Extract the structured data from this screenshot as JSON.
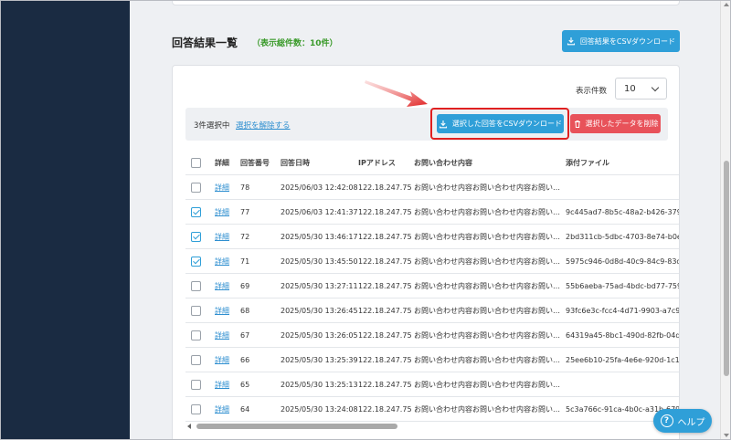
{
  "page": {
    "title": "回答結果一覧",
    "total_count": "（表示総件数：10件）",
    "download_all_label": "回答結果をCSVダウンロード"
  },
  "pagination": {
    "per_page_label": "表示件数",
    "per_page_value": "10"
  },
  "selection": {
    "count_label": "3件選択中",
    "clear_label": "選択を解除する",
    "download_selected_label": "選択した回答をCSVダウンロード",
    "delete_selected_label": "選択したデータを削除"
  },
  "table": {
    "headers": {
      "detail": "詳細",
      "no": "回答番号",
      "date": "回答日時",
      "ip": "IPアドレス",
      "body": "お問い合わせ内容",
      "file": "添付ファイル"
    },
    "rows": [
      {
        "checked": false,
        "detail": "詳細",
        "no": "78",
        "date": "2025/06/03 12:42:08",
        "ip": "122.18.247.75",
        "body": "お問い合わせ内容お問い合わせ内容お問い…",
        "file": ""
      },
      {
        "checked": true,
        "detail": "詳細",
        "no": "77",
        "date": "2025/06/03 12:41:37",
        "ip": "122.18.247.75",
        "body": "お問い合わせ内容お問い合わせ内容お問い…",
        "file": "9c445ad7-8b5c-48a2-b426-3793"
      },
      {
        "checked": true,
        "detail": "詳細",
        "no": "72",
        "date": "2025/05/30 13:46:17",
        "ip": "122.18.247.75",
        "body": "お問い合わせ内容お問い合わせ内容お問い…",
        "file": "2bd311cb-5dbc-4703-8e74-b0ee"
      },
      {
        "checked": true,
        "detail": "詳細",
        "no": "71",
        "date": "2025/05/30 13:45:50",
        "ip": "122.18.247.75",
        "body": "お問い合わせ内容お問い合わせ内容お問い…",
        "file": "5975c946-0d8d-40c9-84c9-83d6"
      },
      {
        "checked": false,
        "detail": "詳細",
        "no": "69",
        "date": "2025/05/30 13:27:11",
        "ip": "122.18.247.75",
        "body": "お問い合わせ内容お問い合わせ内容お問い…",
        "file": "55b6aeba-75ad-4bdc-bd77-759c"
      },
      {
        "checked": false,
        "detail": "詳細",
        "no": "68",
        "date": "2025/05/30 13:26:45",
        "ip": "122.18.247.75",
        "body": "お問い合わせ内容お問い合わせ内容お問い…",
        "file": "93fc6e3c-fcc4-4d71-9903-a7c9f5"
      },
      {
        "checked": false,
        "detail": "詳細",
        "no": "67",
        "date": "2025/05/30 13:26:05",
        "ip": "122.18.247.75",
        "body": "お問い合わせ内容お問い合わせ内容お問い…",
        "file": "64319a45-8bc1-490d-82fb-04da5"
      },
      {
        "checked": false,
        "detail": "詳細",
        "no": "66",
        "date": "2025/05/30 13:25:39",
        "ip": "122.18.247.75",
        "body": "お問い合わせ内容お問い合わせ内容お問い…",
        "file": "25ee6b10-25fa-4e6e-920d-1c105"
      },
      {
        "checked": false,
        "detail": "詳細",
        "no": "65",
        "date": "2025/05/30 13:25:13",
        "ip": "122.18.247.75",
        "body": "お問い合わせ内容お問い合わせ内容お問い…",
        "file": ""
      },
      {
        "checked": false,
        "detail": "詳細",
        "no": "64",
        "date": "2025/05/30 13:24:08",
        "ip": "122.18.247.75",
        "body": "お問い合わせ内容お問い合わせ内容お問い…",
        "file": "5c3a766c-91ca-4b0c-a31b-679"
      }
    ]
  },
  "help": {
    "label": "ヘルプ",
    "icon": "question-circle-icon"
  },
  "colors": {
    "sidebar": "#1a2b42",
    "primary": "#2f9fd8",
    "danger": "#e8525a",
    "count_green": "#3a9a2a",
    "highlight": "#e02020"
  }
}
